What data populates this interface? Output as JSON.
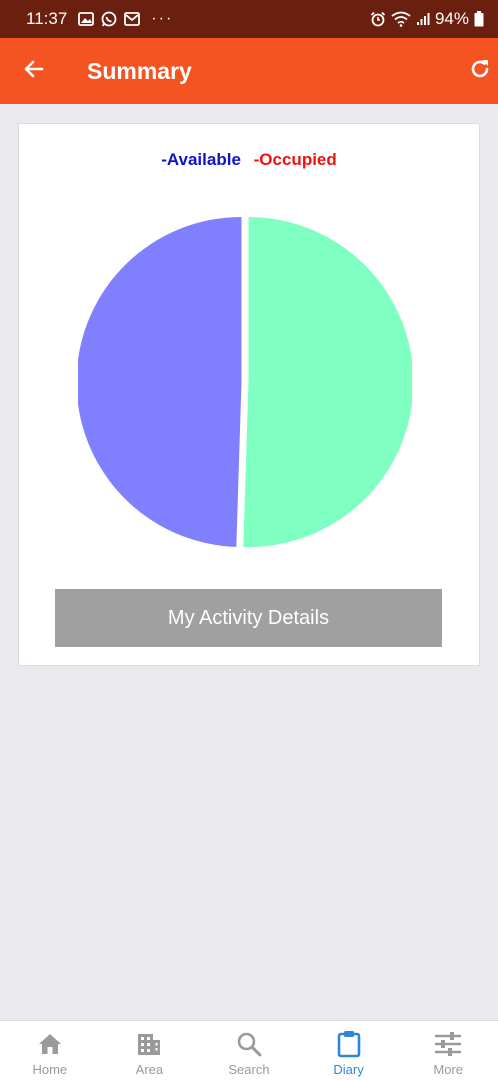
{
  "status_bar": {
    "time": "11:37",
    "dots": "···",
    "battery": "94%",
    "icons": [
      "image-icon",
      "whatsapp-icon",
      "mail-icon",
      "alarm-icon",
      "wifi-icon",
      "signal-icon",
      "battery-icon"
    ]
  },
  "header": {
    "title": "Summary",
    "back_icon": "arrow-left-icon",
    "refresh_icon": "refresh-icon",
    "background": "#f65322"
  },
  "chart_data": {
    "type": "pie",
    "legend": [
      {
        "label": "-Available",
        "color": "#1212c8"
      },
      {
        "label": "-Occupied",
        "color": "#f01212"
      }
    ],
    "slices": [
      {
        "value": 50.5,
        "color": "#80ffc2"
      },
      {
        "value": 49.5,
        "color": "#8080ff"
      }
    ]
  },
  "card": {
    "button_label": "My Activity Details"
  },
  "bottom_nav": {
    "items": [
      {
        "label": "Home",
        "icon": "home-icon",
        "active": false
      },
      {
        "label": "Area",
        "icon": "building-icon",
        "active": false
      },
      {
        "label": "Search",
        "icon": "search-icon",
        "active": false
      },
      {
        "label": "Diary",
        "icon": "clipboard-icon",
        "active": true
      },
      {
        "label": "More",
        "icon": "sliders-icon",
        "active": false
      }
    ],
    "active_color": "#2f86d6",
    "inactive_color": "#9a9a9a"
  }
}
